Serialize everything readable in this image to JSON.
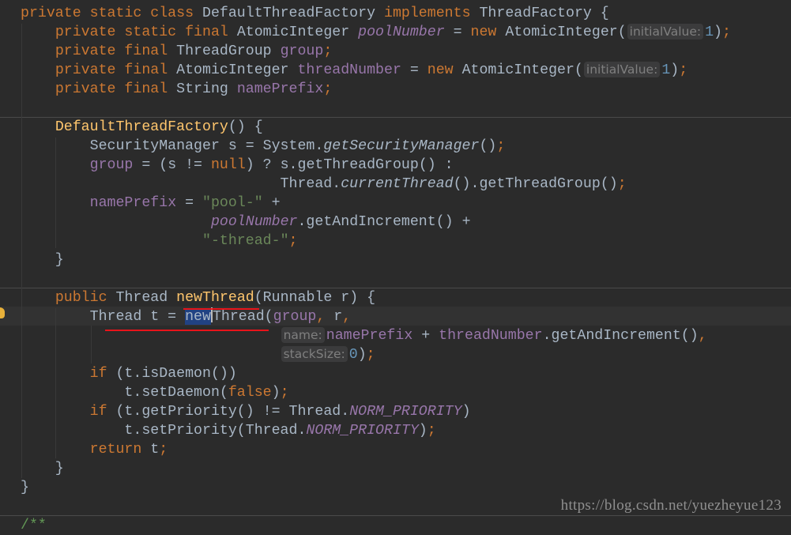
{
  "colors": {
    "background": "#2b2b2b",
    "keyword": "#cc7832",
    "field": "#9876aa",
    "method_declaration": "#ffc66d",
    "string": "#6a8759",
    "number": "#6897bb",
    "text": "#a9b7c6",
    "selection": "#214283",
    "annotation_underline": "#e8141a"
  },
  "icons": {
    "gutter": "lightbulb-icon"
  },
  "code": [
    [
      [
        "kw",
        "private static class "
      ],
      [
        "",
        "DefaultThreadFactory "
      ],
      [
        "kw",
        "implements "
      ],
      [
        "",
        "ThreadFactory {"
      ]
    ],
    [
      [
        "",
        "    "
      ],
      [
        "kw",
        "private static final "
      ],
      [
        "",
        "AtomicInteger "
      ],
      [
        "sfield",
        "poolNumber"
      ],
      [
        "",
        " = "
      ],
      [
        "kw",
        "new "
      ],
      [
        "",
        "AtomicInteger("
      ],
      [
        "hint",
        "initialValue:"
      ],
      [
        "num",
        "1"
      ],
      [
        "",
        ")"
      ],
      [
        "kw",
        ";"
      ]
    ],
    [
      [
        "",
        "    "
      ],
      [
        "kw",
        "private final "
      ],
      [
        "",
        "ThreadGroup "
      ],
      [
        "field",
        "group"
      ],
      [
        "kw",
        ";"
      ]
    ],
    [
      [
        "",
        "    "
      ],
      [
        "kw",
        "private final "
      ],
      [
        "",
        "AtomicInteger "
      ],
      [
        "field",
        "threadNumber"
      ],
      [
        "",
        " = "
      ],
      [
        "kw",
        "new "
      ],
      [
        "",
        "AtomicInteger("
      ],
      [
        "hint",
        "initialValue:"
      ],
      [
        "num",
        "1"
      ],
      [
        "",
        ")"
      ],
      [
        "kw",
        ";"
      ]
    ],
    [
      [
        "",
        "    "
      ],
      [
        "kw",
        "private final "
      ],
      [
        "",
        "String "
      ],
      [
        "field",
        "namePrefix"
      ],
      [
        "kw",
        ";"
      ]
    ],
    [],
    [
      [
        "",
        "    "
      ],
      [
        "decl",
        "DefaultThreadFactory"
      ],
      [
        "",
        "() {"
      ]
    ],
    [
      [
        "",
        "        SecurityManager s = System."
      ],
      [
        "smethod",
        "getSecurityManager"
      ],
      [
        "",
        "()"
      ],
      [
        "kw",
        ";"
      ]
    ],
    [
      [
        "",
        "        "
      ],
      [
        "field",
        "group"
      ],
      [
        "",
        " = (s != "
      ],
      [
        "kw",
        "null"
      ],
      [
        "",
        ") ? s.getThreadGroup() :"
      ]
    ],
    [
      [
        "",
        "                              Thread."
      ],
      [
        "smethod",
        "currentThread"
      ],
      [
        "",
        "().getThreadGroup()"
      ],
      [
        "kw",
        ";"
      ]
    ],
    [
      [
        "",
        "        "
      ],
      [
        "field",
        "namePrefix"
      ],
      [
        "",
        " = "
      ],
      [
        "str",
        "\"pool-\""
      ],
      [
        "",
        " +"
      ]
    ],
    [
      [
        "",
        "                      "
      ],
      [
        "sfield",
        "poolNumber"
      ],
      [
        "",
        ".getAndIncrement() +"
      ]
    ],
    [
      [
        "",
        "                     "
      ],
      [
        "str",
        "\"-thread-\""
      ],
      [
        "kw",
        ";"
      ]
    ],
    [
      [
        "",
        "    }"
      ]
    ],
    [],
    [
      [
        "",
        "    "
      ],
      [
        "kw",
        "public "
      ],
      [
        "",
        "Thread "
      ],
      [
        "decl",
        "newThread"
      ],
      [
        "",
        "(Runnable r) {"
      ]
    ],
    [
      [
        "",
        "        Thread t = "
      ],
      [
        "sel",
        "new"
      ],
      [
        "caret",
        ""
      ],
      [
        "",
        "Thread("
      ],
      [
        "field",
        "group"
      ],
      [
        "kw",
        ", "
      ],
      [
        "",
        "r"
      ],
      [
        "kw",
        ","
      ]
    ],
    [
      [
        "",
        "                              "
      ],
      [
        "hint",
        "name:"
      ],
      [
        "field",
        "namePrefix"
      ],
      [
        "",
        " + "
      ],
      [
        "field",
        "threadNumber"
      ],
      [
        "",
        ".getAndIncrement()"
      ],
      [
        "kw",
        ","
      ]
    ],
    [
      [
        "",
        "                              "
      ],
      [
        "hint",
        "stackSize:"
      ],
      [
        "num",
        "0"
      ],
      [
        "",
        ")"
      ],
      [
        "kw",
        ";"
      ]
    ],
    [
      [
        "",
        "        "
      ],
      [
        "kw",
        "if "
      ],
      [
        "",
        "(t.isDaemon())"
      ]
    ],
    [
      [
        "",
        "            t.setDaemon("
      ],
      [
        "kw",
        "false"
      ],
      [
        "",
        ")"
      ],
      [
        "kw",
        ";"
      ]
    ],
    [
      [
        "",
        "        "
      ],
      [
        "kw",
        "if "
      ],
      [
        "",
        "(t.getPriority() != Thread."
      ],
      [
        "sfield",
        "NORM_PRIORITY"
      ],
      [
        "",
        ")"
      ]
    ],
    [
      [
        "",
        "            t.setPriority(Thread."
      ],
      [
        "sfield",
        "NORM_PRIORITY"
      ],
      [
        "",
        ")"
      ],
      [
        "kw",
        ";"
      ]
    ],
    [
      [
        "",
        "        "
      ],
      [
        "kw",
        "return "
      ],
      [
        "",
        "t"
      ],
      [
        "kw",
        ";"
      ]
    ],
    [
      [
        "",
        "    }"
      ]
    ],
    [
      [
        "",
        "}"
      ]
    ],
    [],
    [
      [
        "cmt",
        "/**"
      ]
    ]
  ],
  "watermark": "https://blog.csdn.net/yuezheyue123"
}
